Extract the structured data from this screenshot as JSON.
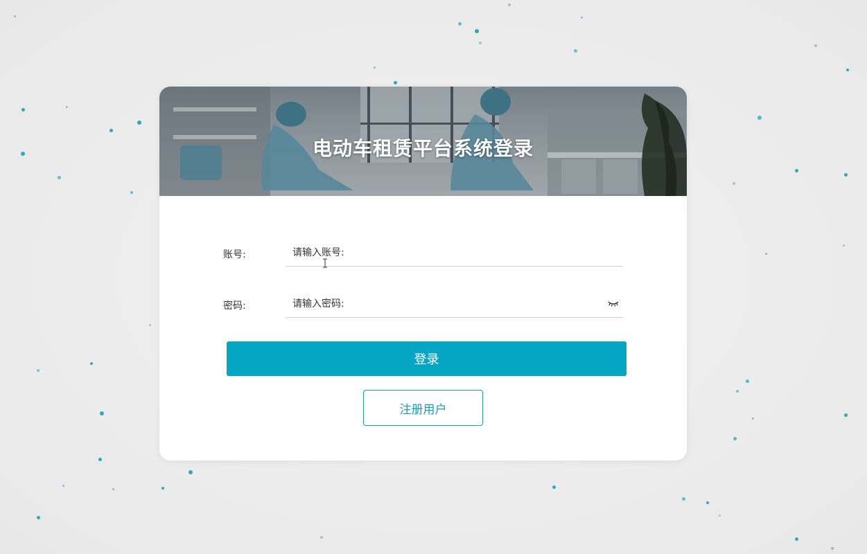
{
  "title": "电动车租赁平台系统登录",
  "account": {
    "label": "账号:",
    "placeholder": "请输入账号:"
  },
  "password": {
    "label": "密码:",
    "placeholder": "请输入密码:",
    "toggle_icon": "eye-closed-icon"
  },
  "login_label": "登录",
  "register_label": "注册用户",
  "colors": {
    "primary": "#05a6c4",
    "register_border": "#1b9db7",
    "background": "#ececec",
    "dots": "#2fa9bf"
  }
}
